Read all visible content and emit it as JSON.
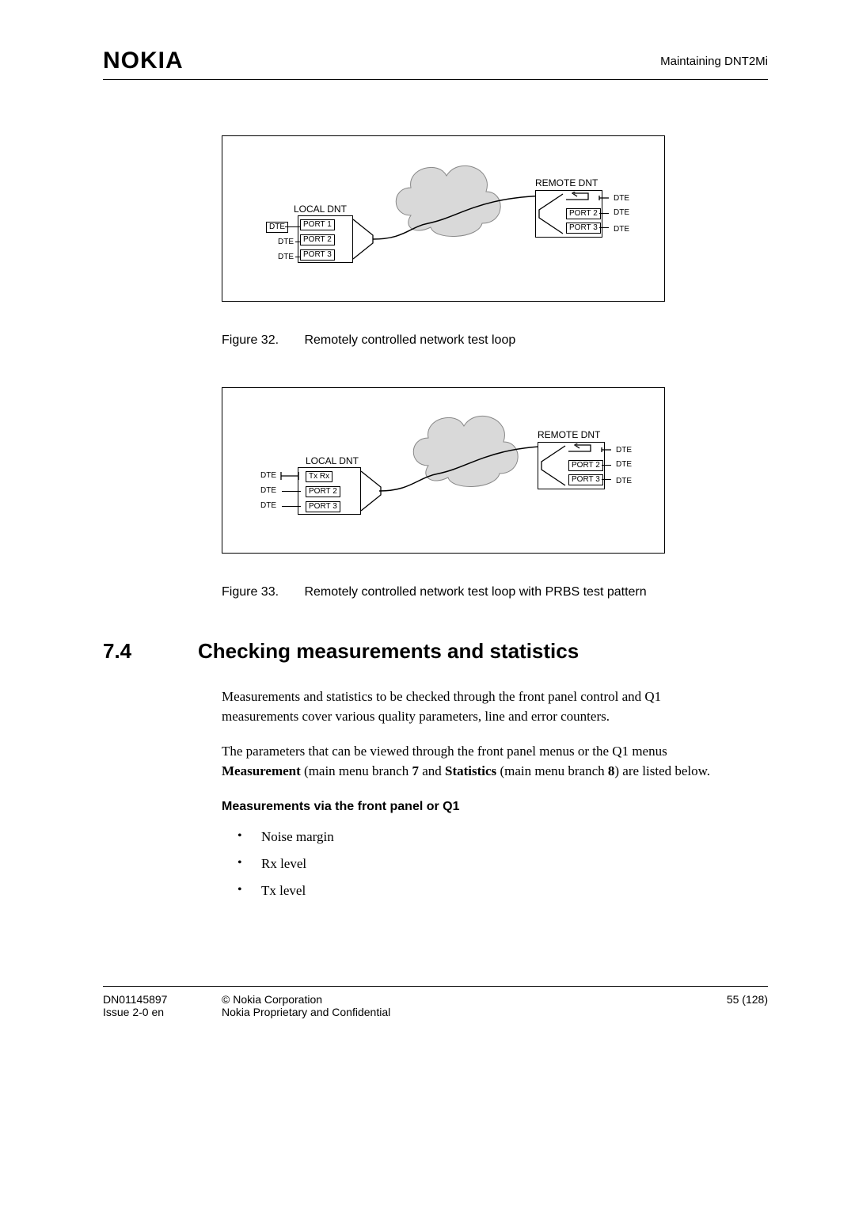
{
  "logo": "NOKIA",
  "doc_title": "Maintaining DNT2Mi",
  "fig32": {
    "caption_label": "Figure 32.",
    "caption_text": "Remotely controlled network test loop",
    "local_title": "LOCAL DNT",
    "remote_title": "REMOTE DNT",
    "port1": "PORT 1",
    "port2": "PORT 2",
    "port3": "PORT 3",
    "dte": "DTE"
  },
  "fig33": {
    "caption_label": "Figure 33.",
    "caption_text": "Remotely controlled network test loop with PRBS test pattern",
    "local_title": "LOCAL DNT",
    "remote_title": "REMOTE DNT",
    "txrx": "Tx Rx",
    "port2": "PORT 2",
    "port3": "PORT 3",
    "dte": "DTE"
  },
  "section": {
    "num": "7.4",
    "title": "Checking measurements and statistics",
    "p1": "Measurements and statistics to be checked through the front panel control and Q1 measurements cover various quality parameters, line and error counters.",
    "p2a": "The parameters that can be viewed through the front panel menus or the Q1 menus ",
    "p2b": "Measurement",
    "p2c": " (main menu branch ",
    "p2d": "7",
    "p2e": " and ",
    "p2f": "Statistics",
    "p2g": " (main menu branch ",
    "p2h": "8",
    "p2i": ") are listed below.",
    "subhead": "Measurements via the front panel or Q1",
    "bullets": [
      "Noise margin",
      "Rx level",
      "Tx level"
    ]
  },
  "footer": {
    "dn": "DN01145897",
    "issue": "Issue 2-0 en",
    "copyright": "© Nokia Corporation",
    "confidential": "Nokia Proprietary and Confidential",
    "page": "55 (128)"
  }
}
